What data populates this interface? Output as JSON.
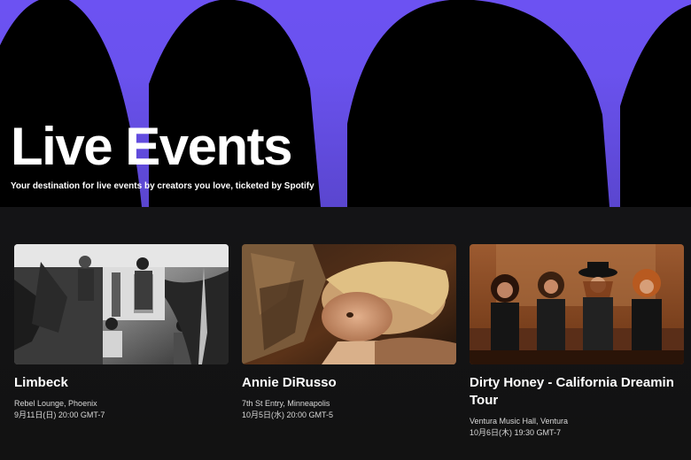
{
  "colors": {
    "hero_purple": "#6c52f2",
    "arch_black": "#000000",
    "background": "#121212",
    "text_primary": "#ffffff",
    "text_secondary": "#d8d8d8"
  },
  "hero": {
    "title": "Live Events",
    "subtitle": "Your destination for live events by creators you love, ticketed by Spotify"
  },
  "events": [
    {
      "title": "Limbeck",
      "venue": "Rebel Lounge, Phoenix",
      "datetime": "9月11日(日) 20:00 GMT-7",
      "image": "band-photo-black-and-white"
    },
    {
      "title": "Annie DiRusso",
      "venue": "7th St Entry, Minneapolis",
      "datetime": "10月5日(水) 20:00 GMT-5",
      "image": "artist-portrait-warm-tone"
    },
    {
      "title": "Dirty Honey - California Dreamin Tour",
      "venue": "Ventura Music Hall, Ventura",
      "datetime": "10月6日(木) 19:30 GMT-7",
      "image": "band-photo-on-couch"
    }
  ]
}
